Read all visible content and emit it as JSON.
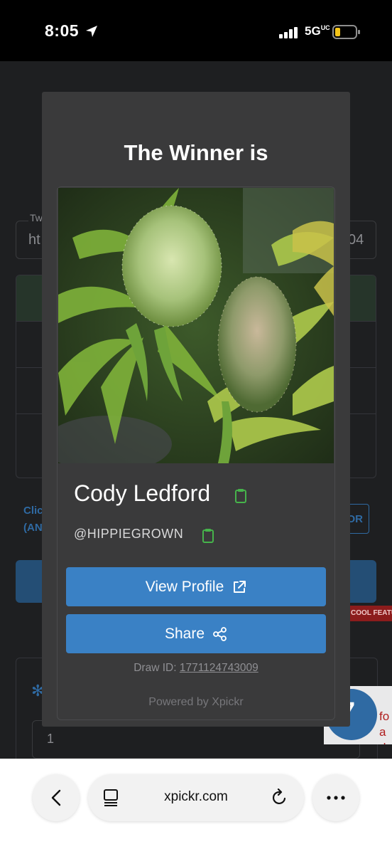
{
  "status_bar": {
    "time": "8:05",
    "network": "5G",
    "network_suffix": "UC",
    "icons": [
      "location-arrow-icon",
      "signal-icon",
      "battery-low-icon"
    ]
  },
  "background_page": {
    "field_label": "Tw",
    "field_value": "ht",
    "field_end": "04",
    "click_text_line1": "Clic",
    "click_text_line2": "(AN",
    "or_button": "OR",
    "cool_badge": "COOL FEATU",
    "input_value": "1",
    "promo_line1": "fo",
    "promo_line2": "a do"
  },
  "modal": {
    "title": "The Winner is",
    "winner_name": "Cody Ledford",
    "handle": "@HIPPIEGROWN",
    "view_profile_label": "View Profile",
    "share_label": "Share",
    "draw_id_label": "Draw ID:",
    "draw_id_value": "1771124743009",
    "powered_by": "Powered by Xpickr",
    "accent_color": "#3a81c5",
    "copy_icon_color": "#46b34b"
  },
  "browser_bar": {
    "url": "xpickr.com",
    "icons": [
      "back-chevron-icon",
      "tabs-icon",
      "reload-icon",
      "more-icon"
    ]
  }
}
